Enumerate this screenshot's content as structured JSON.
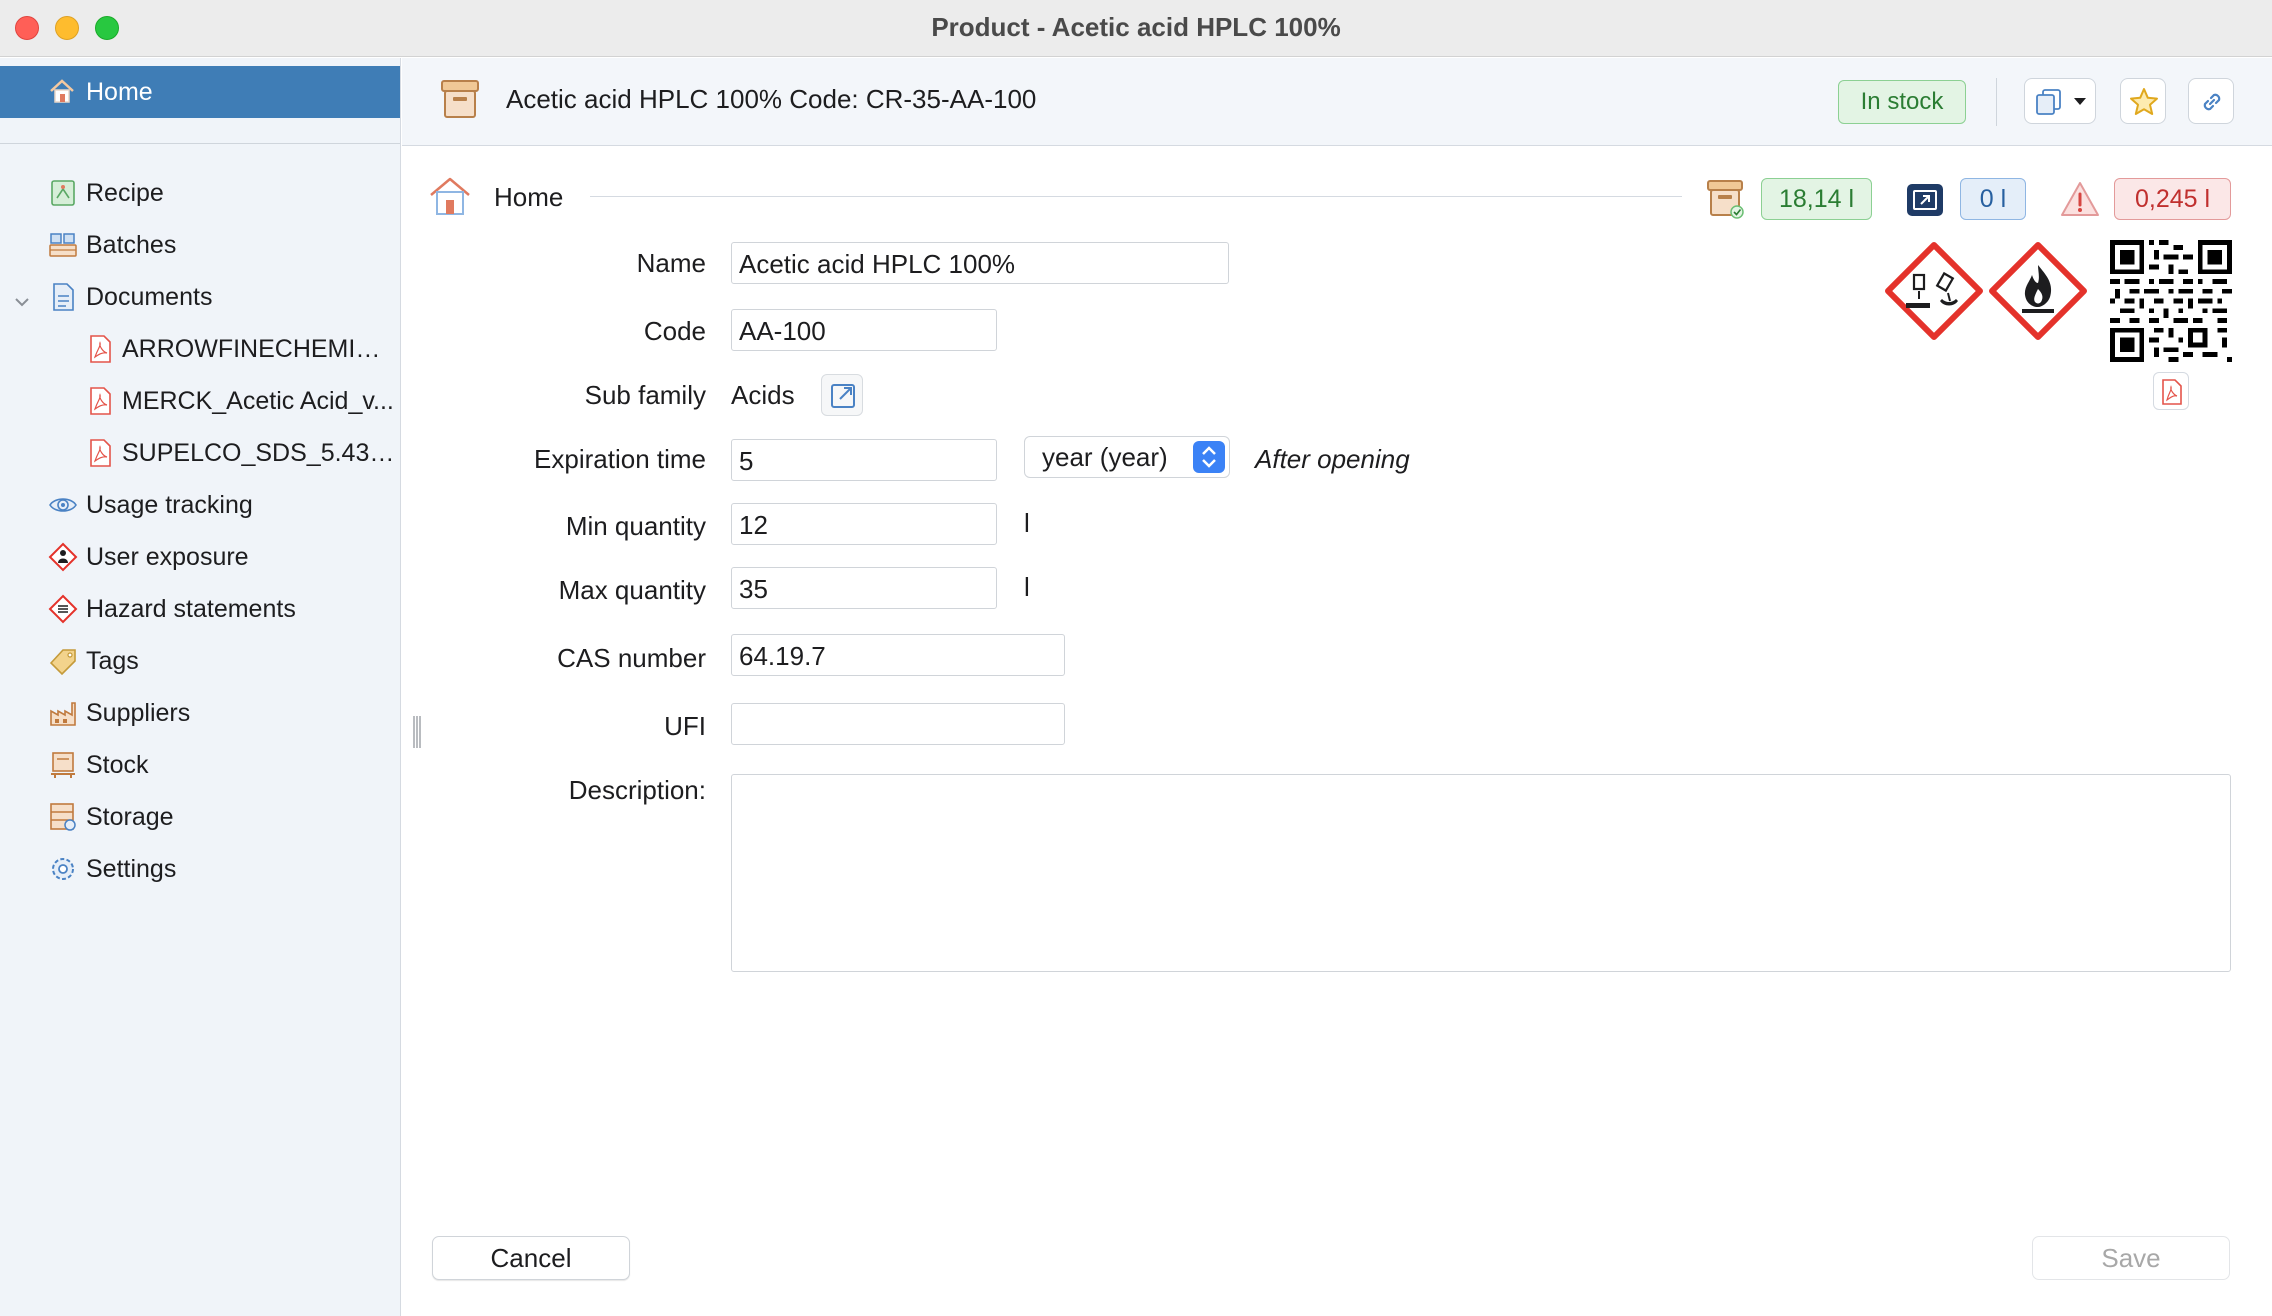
{
  "window": {
    "title": "Product - Acetic acid HPLC 100%"
  },
  "sidebar": {
    "home": "Home",
    "items": [
      {
        "label": "Recipe",
        "icon": "recipe-icon"
      },
      {
        "label": "Batches",
        "icon": "batches-icon"
      },
      {
        "label": "Documents",
        "icon": "documents-icon",
        "expanded": true
      },
      {
        "label": "ARROWFINECHEMICA...",
        "icon": "pdf-icon"
      },
      {
        "label": "MERCK_Acetic Acid_v...",
        "icon": "pdf-icon"
      },
      {
        "label": "SUPELCO_SDS_5.438...",
        "icon": "pdf-icon"
      },
      {
        "label": "Usage tracking",
        "icon": "eye-icon"
      },
      {
        "label": "User exposure",
        "icon": "exposure-icon"
      },
      {
        "label": "Hazard statements",
        "icon": "hazard-list-icon"
      },
      {
        "label": "Tags",
        "icon": "tag-icon"
      },
      {
        "label": "Suppliers",
        "icon": "factory-icon"
      },
      {
        "label": "Stock",
        "icon": "stock-icon"
      },
      {
        "label": "Storage",
        "icon": "storage-icon"
      },
      {
        "label": "Settings",
        "icon": "gear-icon"
      }
    ]
  },
  "header": {
    "title": "Acetic acid HPLC 100% Code: CR-35-AA-100",
    "status": "In stock"
  },
  "breadcrumb": {
    "label": "Home"
  },
  "quantities": {
    "in_stock": "18,14 l",
    "opened": "0 l",
    "alert": "0,245 l"
  },
  "form": {
    "name_label": "Name",
    "name_value": "Acetic acid HPLC 100%",
    "code_label": "Code",
    "code_value": "AA-100",
    "subfamily_label": "Sub family",
    "subfamily_value": "Acids",
    "expiration_label": "Expiration time",
    "expiration_value": "5",
    "expiration_unit": "year (year)",
    "expiration_note": "After opening",
    "min_label": "Min quantity",
    "min_value": "12",
    "min_unit": "l",
    "max_label": "Max quantity",
    "max_value": "35",
    "max_unit": "l",
    "cas_label": "CAS number",
    "cas_value": "64.19.7",
    "ufi_label": "UFI",
    "ufi_value": "",
    "description_label": "Description:",
    "description_value": ""
  },
  "footer": {
    "cancel": "Cancel",
    "save": "Save"
  },
  "colors": {
    "sidebar_selected": "#3f7db6",
    "status_green": "#2b7d33",
    "alert_red": "#c0302e",
    "ghs_red": "#e4322b",
    "select_blue": "#3b82f6"
  }
}
